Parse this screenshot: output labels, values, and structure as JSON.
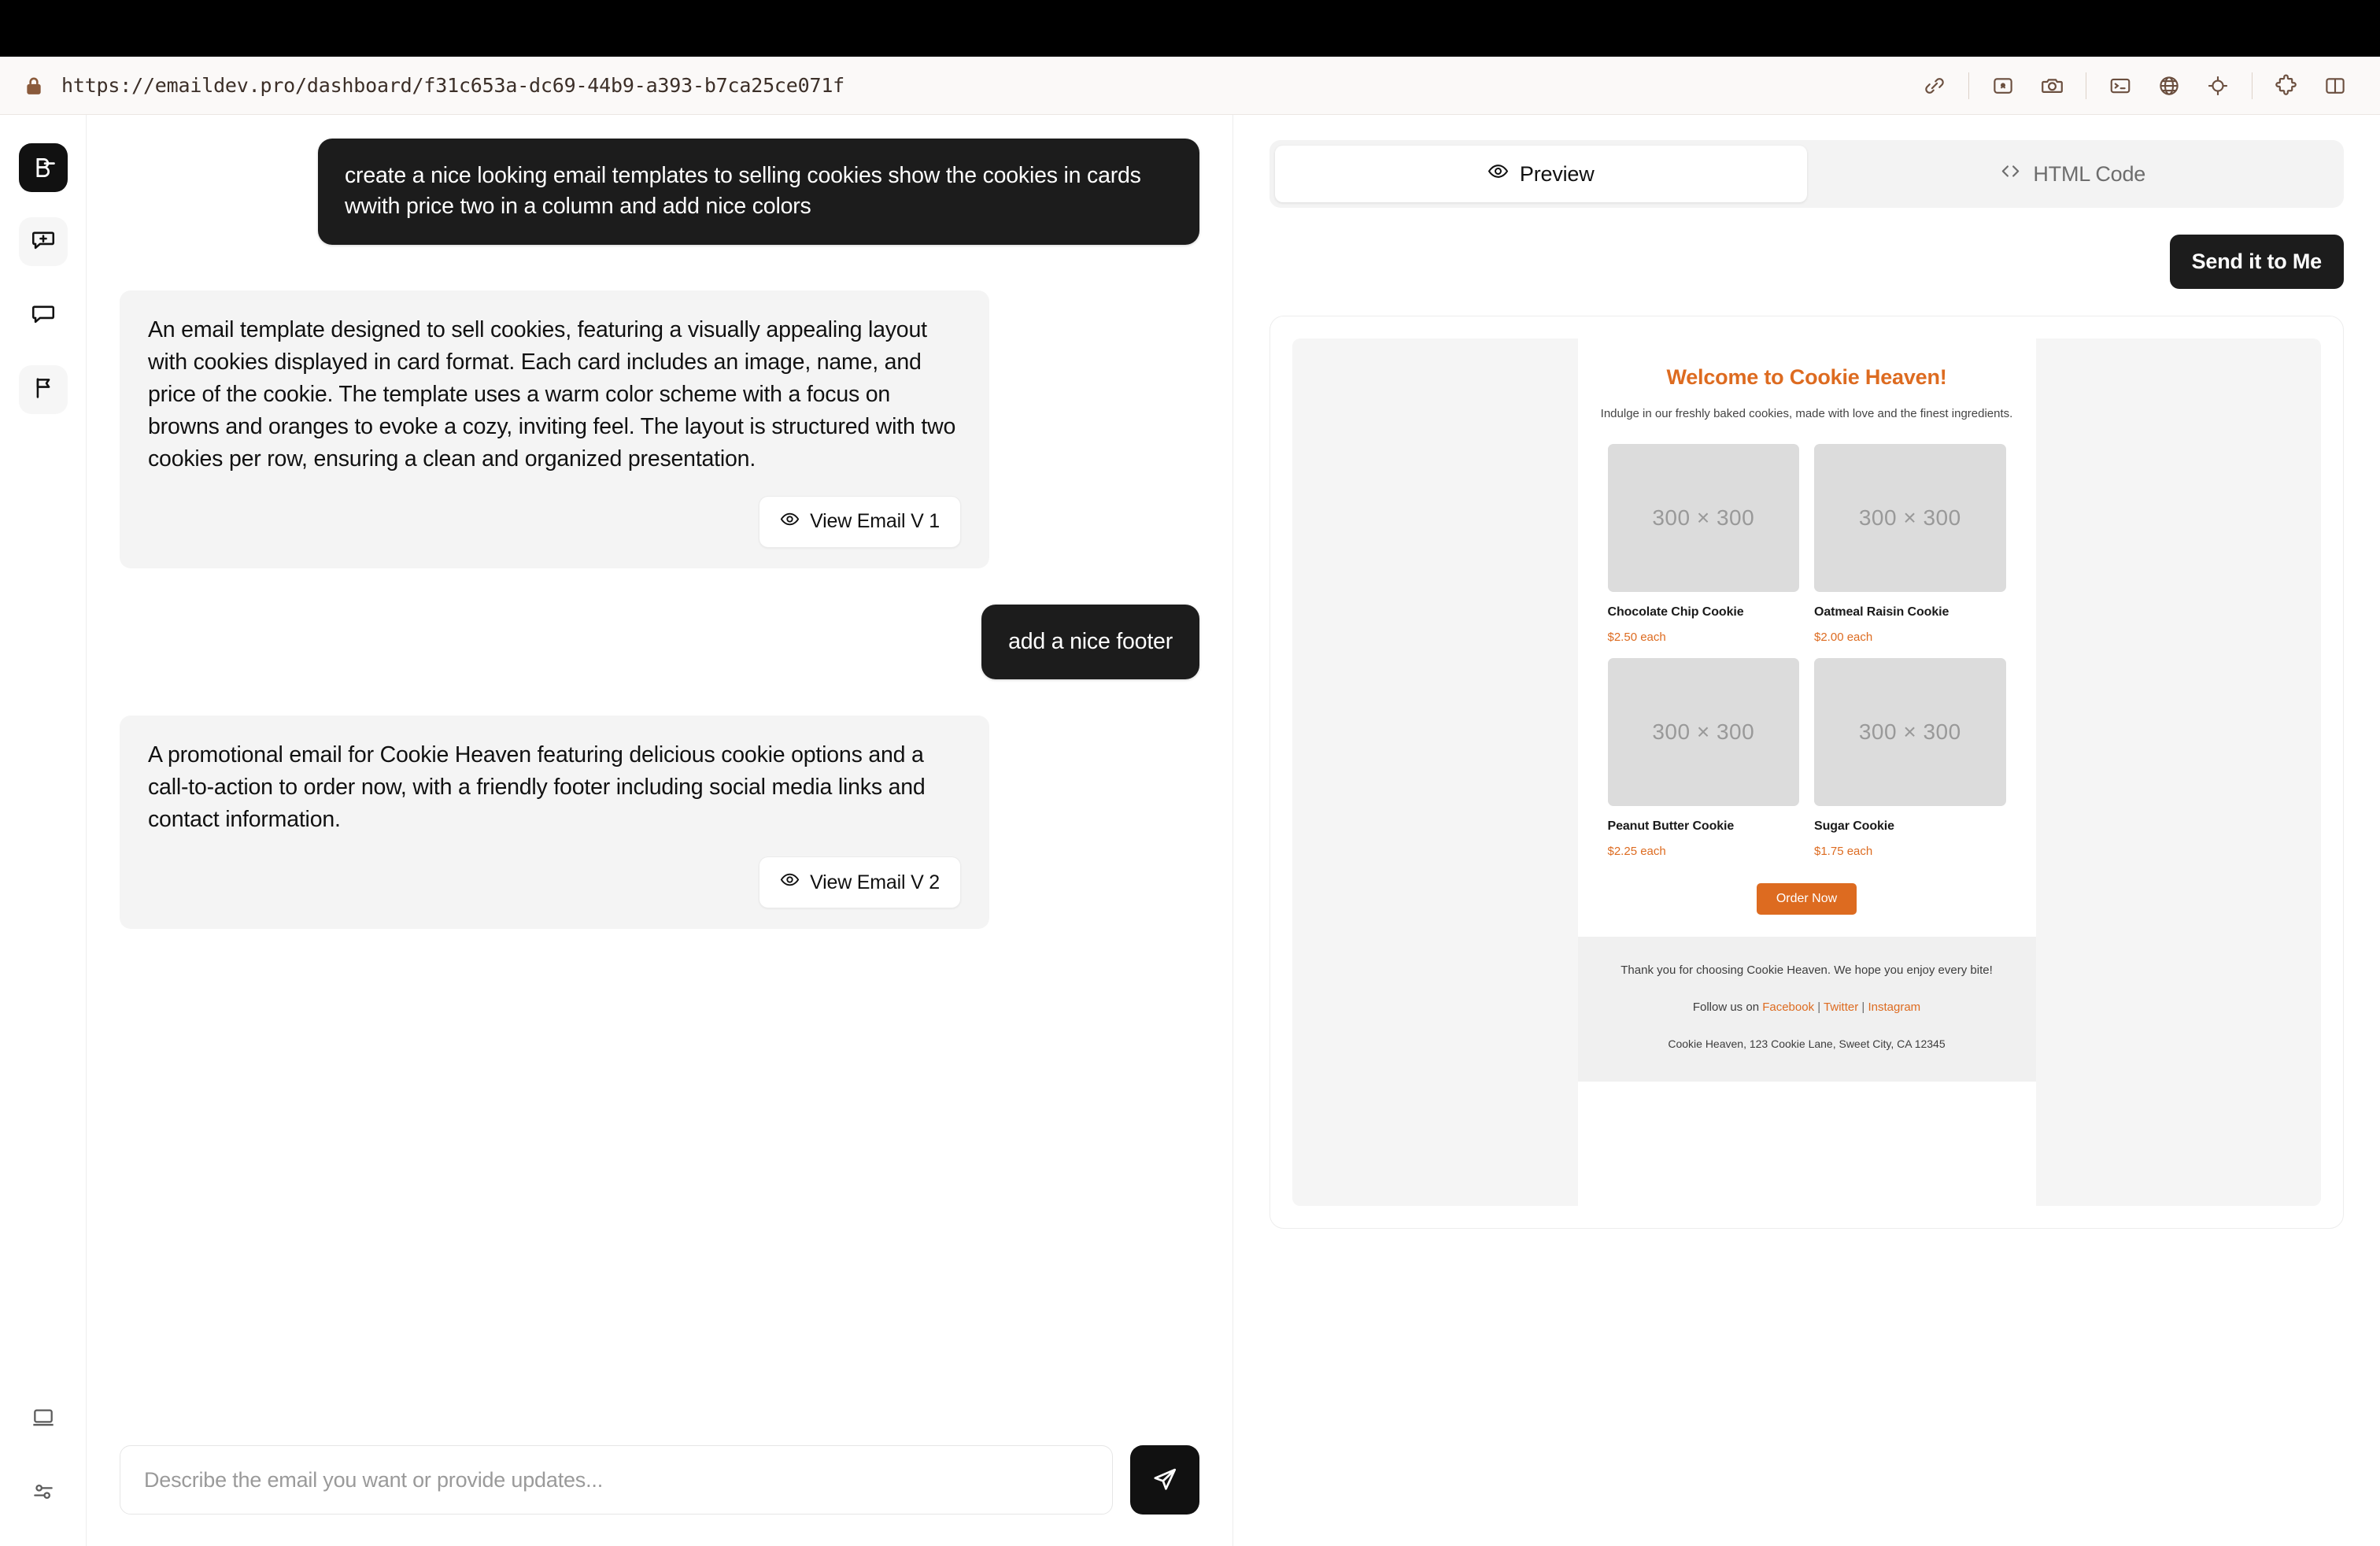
{
  "browser": {
    "url": "https://emaildev.pro/dashboard/f31c653a-dc69-44b9-a393-b7ca25ce071f",
    "lock_icon": "lock-icon",
    "actions": [
      {
        "name": "link-icon"
      },
      {
        "name": "image-placeholder-icon"
      },
      {
        "name": "camera-icon"
      },
      {
        "name": "terminal-icon"
      },
      {
        "name": "globe-icon"
      },
      {
        "name": "target-icon"
      },
      {
        "name": "puzzle-extension-icon"
      },
      {
        "name": "split-panel-icon"
      }
    ]
  },
  "rail": {
    "logo_name": "app-logo",
    "items": [
      {
        "name": "new-chat-icon",
        "active": true
      },
      {
        "name": "chat-icon",
        "active": false
      },
      {
        "name": "flag-icon",
        "active": true
      }
    ],
    "bottom_items": [
      {
        "name": "desktop-icon"
      },
      {
        "name": "settings-sliders-icon"
      }
    ]
  },
  "chat": {
    "messages": [
      {
        "role": "user",
        "text": "create a nice looking email templates to selling cookies show the cookies in cards wwith price two in a column and add nice colors"
      },
      {
        "role": "assistant",
        "text": "An email template designed to sell cookies, featuring a visually appealing layout with cookies displayed in card format. Each card includes an image, name, and price of the cookie. The template uses a warm color scheme with a focus on browns and oranges to evoke a cozy, inviting feel. The layout is structured with two cookies per row, ensuring a clean and organized presentation.",
        "action_label": "View Email V 1"
      },
      {
        "role": "user",
        "text": "add a nice footer"
      },
      {
        "role": "assistant",
        "text": "A promotional email for Cookie Heaven featuring delicious cookie options and a call-to-action to order now, with a friendly footer including social media links and contact information.",
        "action_label": "View Email V 2"
      }
    ],
    "composer": {
      "placeholder": "Describe the email you want or provide updates...",
      "value": "",
      "send_icon": "send-icon"
    }
  },
  "preview_panel": {
    "tabs": [
      {
        "label": "Preview",
        "icon": "eye-icon",
        "active": true
      },
      {
        "label": "HTML Code",
        "icon": "code-brackets-icon",
        "active": false
      }
    ],
    "send_button": "Send it to Me"
  },
  "email": {
    "title": "Welcome to Cookie Heaven!",
    "subtitle": "Indulge in our freshly baked cookies, made with love and the finest ingredients.",
    "image_placeholder_label": "300 × 300",
    "cookies": [
      {
        "name": "Chocolate Chip Cookie",
        "price": "$2.50 each"
      },
      {
        "name": "Oatmeal Raisin Cookie",
        "price": "$2.00 each"
      },
      {
        "name": "Peanut Butter Cookie",
        "price": "$2.25 each"
      },
      {
        "name": "Sugar Cookie",
        "price": "$1.75 each"
      }
    ],
    "cta": "Order Now",
    "footer": {
      "thanks": "Thank you for choosing Cookie Heaven. We hope you enjoy every bite!",
      "follow_prefix": "Follow us on ",
      "links": [
        "Facebook",
        "Twitter",
        "Instagram"
      ],
      "separator": " | ",
      "address": "Cookie Heaven, 123 Cookie Lane, Sweet City, CA 12345"
    }
  },
  "colors": {
    "accent_orange": "#DD6B20",
    "dark": "#1c1c1c",
    "bubble_bot": "#f4f4f4"
  }
}
